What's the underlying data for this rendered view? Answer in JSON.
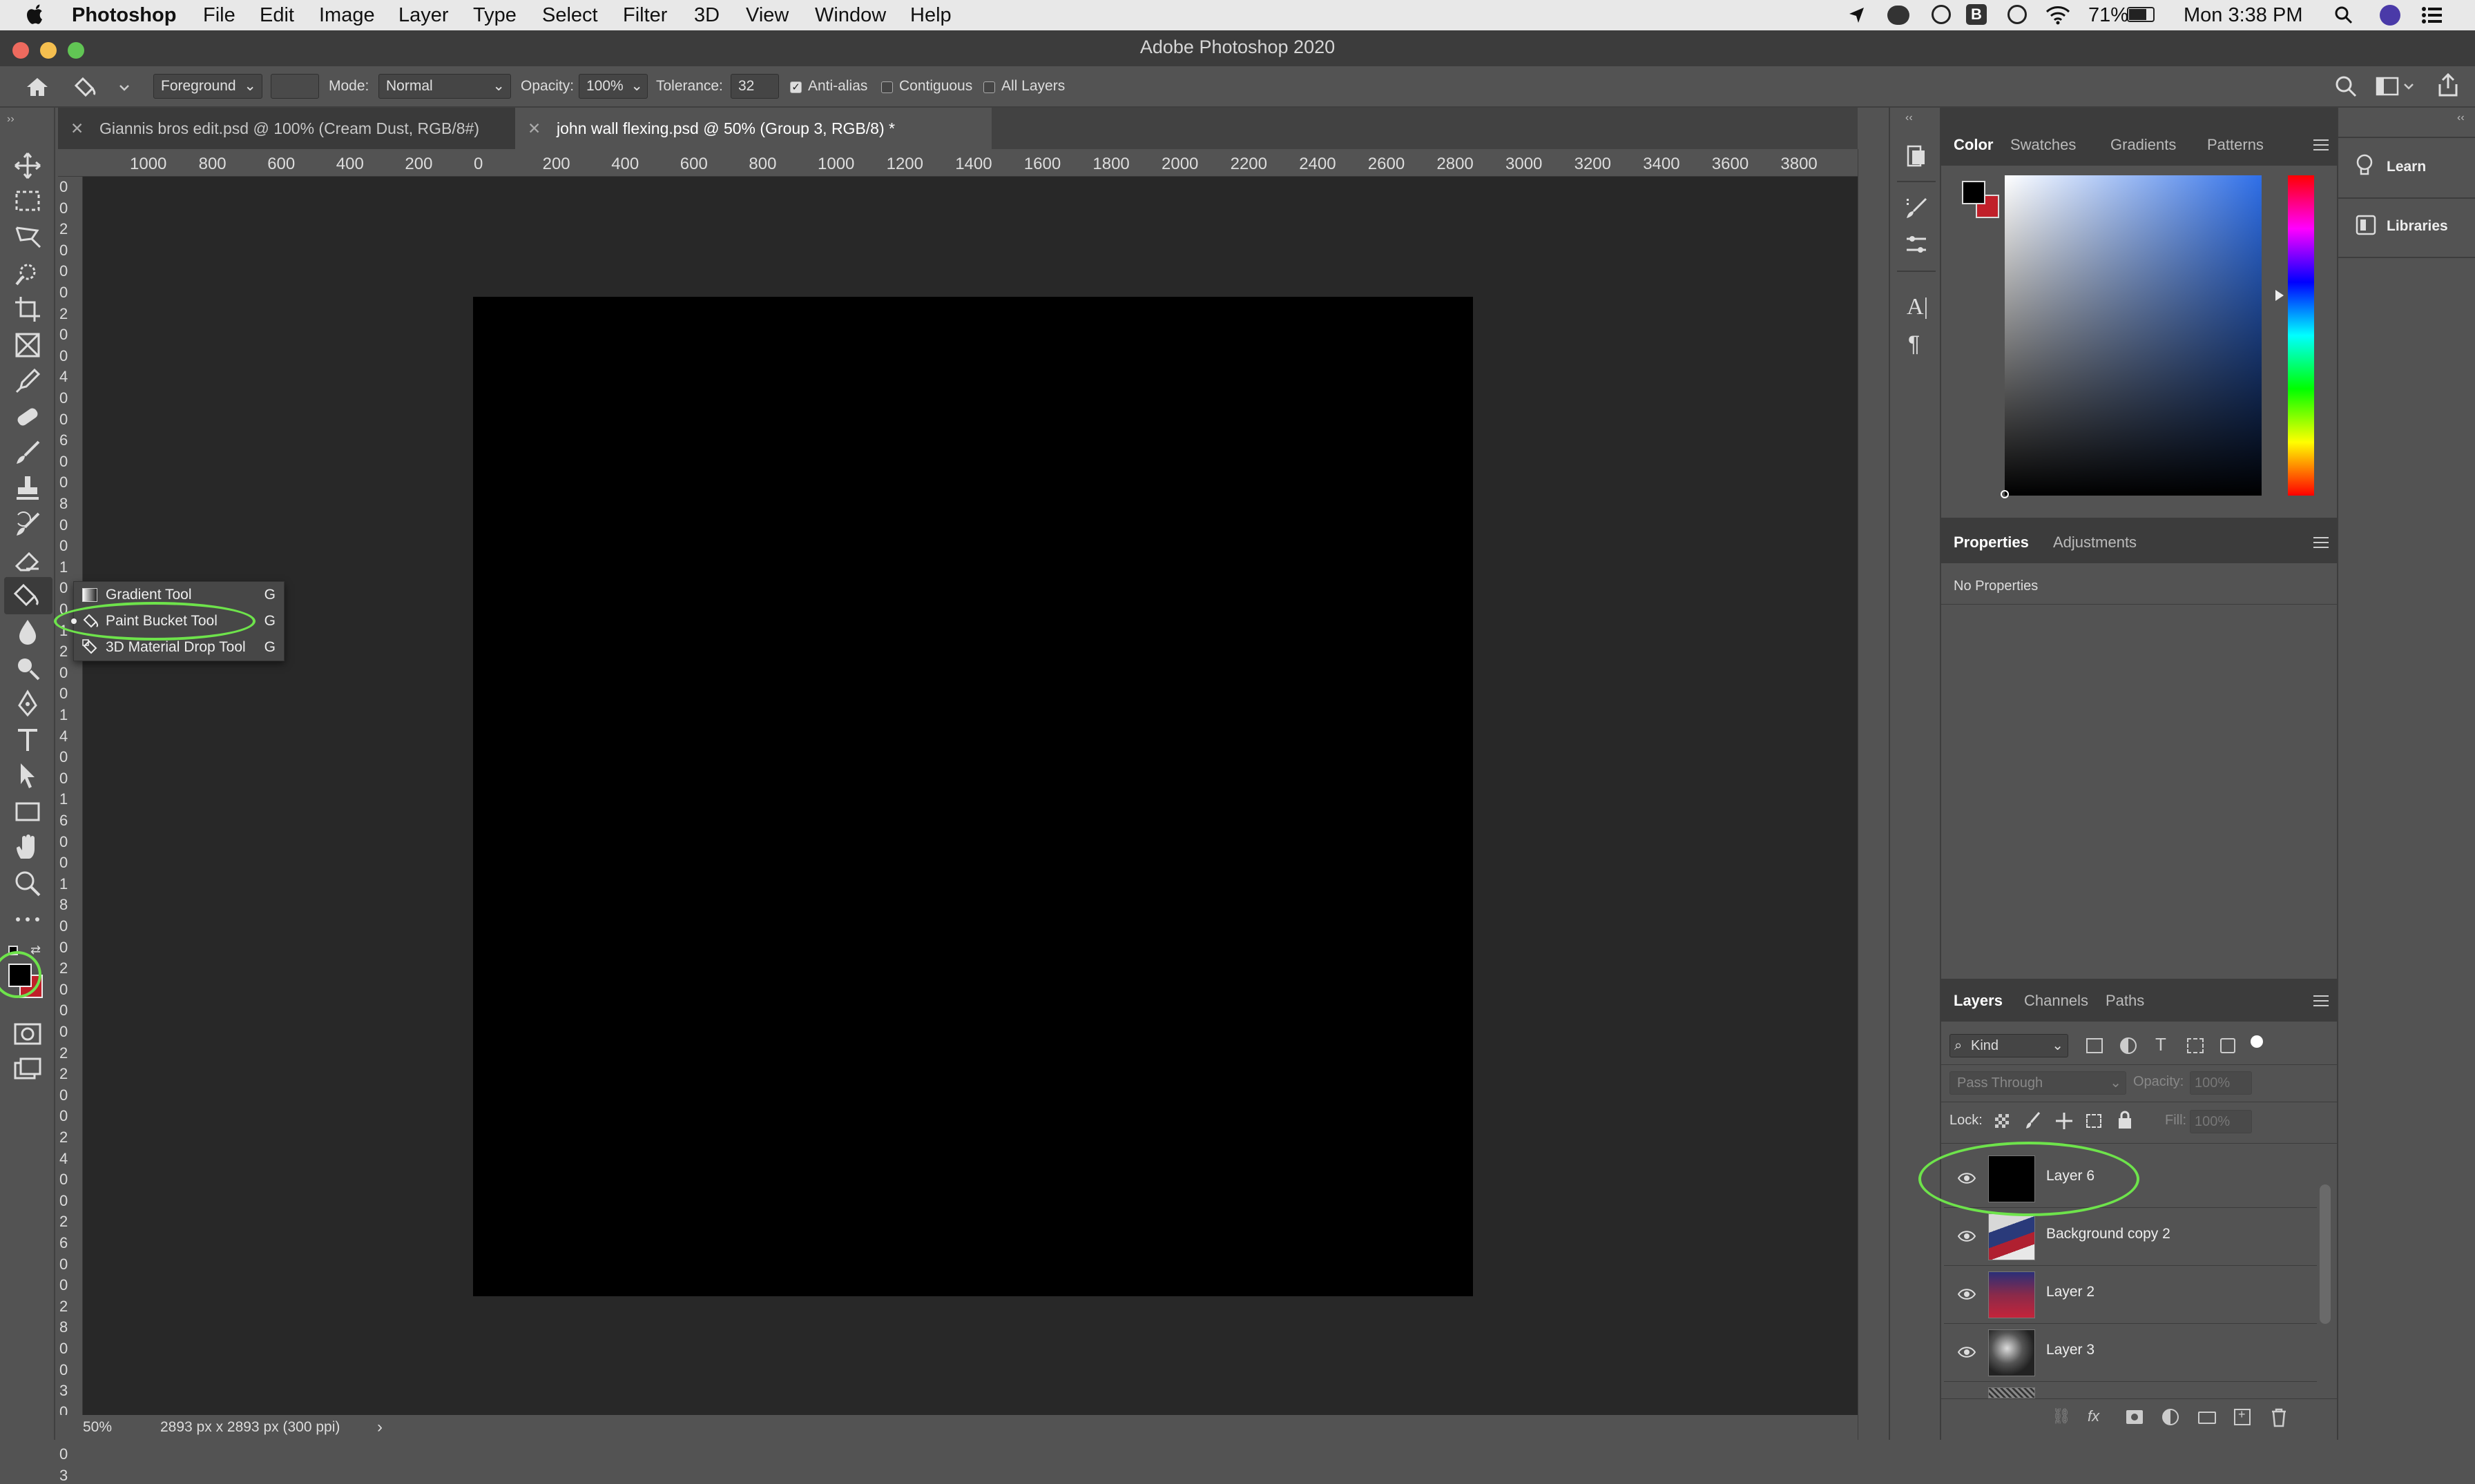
{
  "menubar": {
    "app_name": "Photoshop",
    "items": [
      "File",
      "Edit",
      "Image",
      "Layer",
      "Type",
      "Select",
      "Filter",
      "3D",
      "View",
      "Window",
      "Help"
    ],
    "battery": "71%",
    "clock": "Mon 3:38 PM"
  },
  "window": {
    "title": "Adobe Photoshop 2020"
  },
  "options": {
    "foreground_select": "Foreground",
    "mode_label": "Mode:",
    "mode_value": "Normal",
    "opacity_label": "Opacity:",
    "opacity_value": "100%",
    "tolerance_label": "Tolerance:",
    "tolerance_value": "32",
    "anti_alias": "Anti-alias",
    "contiguous": "Contiguous",
    "all_layers": "All Layers"
  },
  "tabs": [
    {
      "label": "Giannis bros edit.psd @ 100% (Cream Dust, RGB/8#)"
    },
    {
      "label": "john wall flexing.psd @ 50% (Group 3, RGB/8) *"
    }
  ],
  "ruler": {
    "h_ticks": [
      "1000",
      "800",
      "600",
      "400",
      "200",
      "0",
      "200",
      "400",
      "600",
      "800",
      "1000",
      "1200",
      "1400",
      "1600",
      "1800",
      "2000",
      "2200",
      "2400",
      "2600",
      "2800",
      "3000",
      "3200",
      "3400",
      "3600",
      "3800"
    ],
    "v_ticks": [
      "0",
      "0",
      "2",
      "0",
      "0",
      "0",
      "2",
      "0",
      "0",
      "4",
      "0",
      "0",
      "6",
      "0",
      "0",
      "8",
      "0",
      "0",
      "1",
      "0",
      "0",
      "1",
      "2",
      "0",
      "0",
      "1",
      "4",
      "0",
      "0",
      "1",
      "6",
      "0",
      "0",
      "1",
      "8",
      "0",
      "0",
      "2",
      "0",
      "0",
      "0",
      "2",
      "2",
      "0",
      "0",
      "2",
      "4",
      "0",
      "0",
      "2",
      "6",
      "0",
      "0",
      "2",
      "8",
      "0",
      "0",
      "3",
      "0",
      "0",
      "0",
      "3"
    ]
  },
  "flyout": {
    "items": [
      {
        "label": "Gradient Tool",
        "shortcut": "G"
      },
      {
        "label": "Paint Bucket Tool",
        "shortcut": "G"
      },
      {
        "label": "3D Material Drop Tool",
        "shortcut": "G"
      }
    ]
  },
  "status": {
    "zoom": "50%",
    "doc_info": "2893 px x 2893 px (300 ppi)",
    "arrow": "›"
  },
  "color_panel": {
    "tabs": [
      "Color",
      "Swatches",
      "Gradients",
      "Patterns"
    ]
  },
  "properties_panel": {
    "tabs": [
      "Properties",
      "Adjustments"
    ],
    "content": "No Properties"
  },
  "layers_panel": {
    "tabs": [
      "Layers",
      "Channels",
      "Paths"
    ],
    "kind": "Kind",
    "blend_mode": "Pass Through",
    "opacity_label": "Opacity:",
    "opacity_value": "100%",
    "lock_label": "Lock:",
    "fill_label": "Fill:",
    "fill_value": "100%",
    "layers": [
      {
        "name": "Layer 6"
      },
      {
        "name": "Background copy 2"
      },
      {
        "name": "Layer 2"
      },
      {
        "name": "Layer 3"
      }
    ],
    "footer_fx": "fx"
  },
  "far_right": {
    "learn": "Learn",
    "libraries": "Libraries"
  },
  "colors": {
    "accent_ring": "#6ee34b",
    "foreground": "#000000",
    "background": "#c0202a"
  }
}
